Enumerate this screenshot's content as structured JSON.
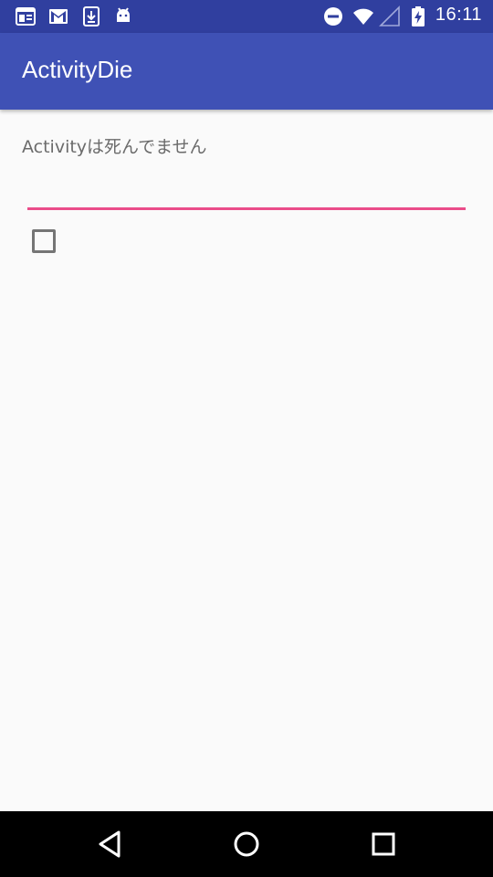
{
  "status_bar": {
    "time": "16:11",
    "left_icons": [
      "news-icon",
      "gmail-icon",
      "download-icon",
      "android-icon"
    ],
    "right_icons": [
      "do-not-disturb-icon",
      "wifi-icon",
      "no-signal-icon",
      "battery-charging-icon"
    ]
  },
  "app_bar": {
    "title": "ActivityDie",
    "color": "#3f51b5",
    "status_color": "#303f9f"
  },
  "main": {
    "status_text": "Activityは死んでません",
    "edit_field": {
      "value": "",
      "placeholder": "",
      "accent_color": "#ea4c89"
    },
    "checkbox": {
      "checked": false
    }
  },
  "nav_bar": {
    "buttons": [
      "back-icon",
      "home-icon",
      "recents-icon"
    ]
  }
}
